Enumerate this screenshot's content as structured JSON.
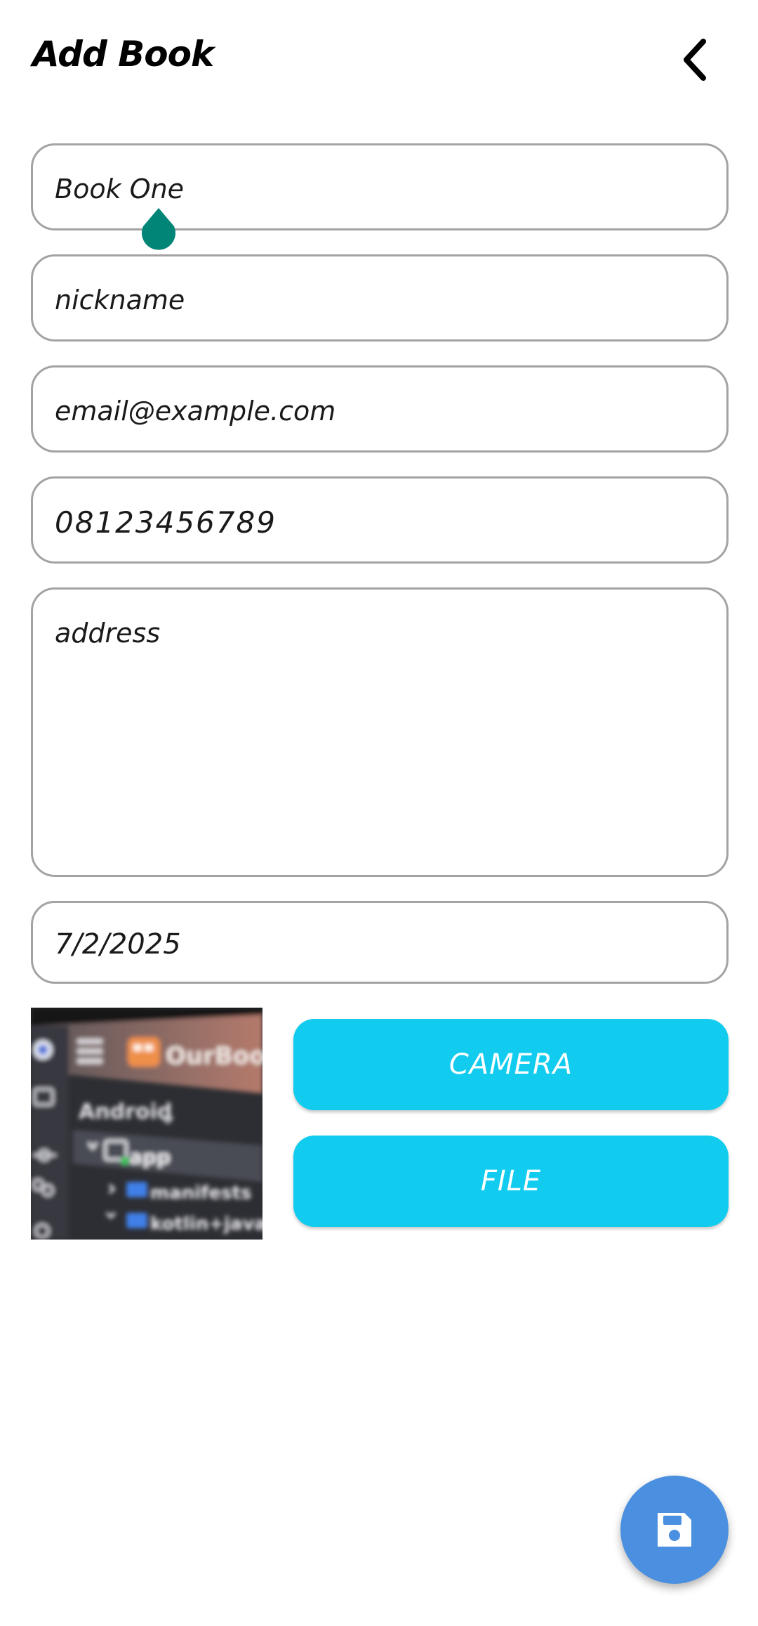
{
  "app_bar": {
    "title": "Add Book",
    "back_icon": "chevron-left-icon"
  },
  "form": {
    "title_value": "Book One",
    "nickname_value": "nickname",
    "email_value": "email@example.com",
    "phone_value": "08123456789",
    "address_value": "address",
    "date_value": "7/2/2025"
  },
  "image_picker": {
    "thumbnail": {
      "app_label": "OurBook",
      "view_label": "Android",
      "tree_items": [
        "app",
        "manifests",
        "kotlin+java"
      ]
    },
    "camera_label": "CAMERA",
    "file_label": "FILE"
  },
  "fab": {
    "icon": "save-icon"
  },
  "colors": {
    "accent": "#11ccee",
    "fab": "#4a8fe0",
    "caret_handle": "#008577",
    "field_border": "#a3a3a3"
  }
}
